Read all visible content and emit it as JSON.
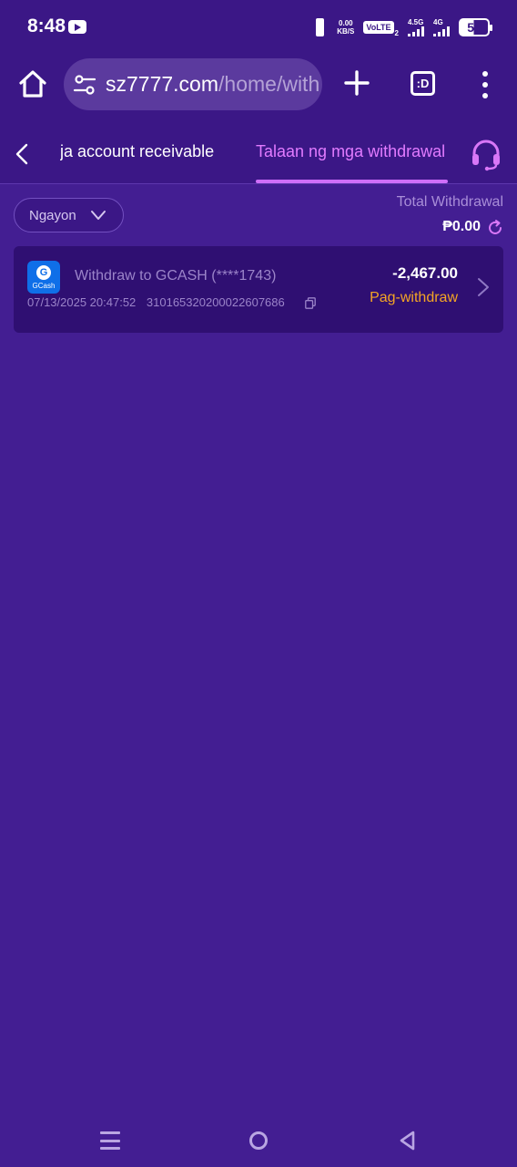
{
  "status_bar": {
    "time": "8:48",
    "net_speed_value": "0.00",
    "net_speed_unit": "KB/S",
    "volte": "VoLTE",
    "volte_sim": "2",
    "signal1_label": "4.5G",
    "signal2_label": "4G",
    "battery": "53"
  },
  "browser": {
    "url_host": "sz7777.com",
    "url_path": "/home/with",
    "tabs_label": ":D"
  },
  "header": {
    "tab_receivable": "ja account receivable",
    "tab_withdrawal": "Talaan ng mga withdrawal"
  },
  "filter": {
    "selected": "Ngayon",
    "total_label": "Total Withdrawal",
    "total_amount": "₱0.00"
  },
  "records": [
    {
      "logo_letter": "G",
      "logo_text": "GCash",
      "title": "Withdraw to GCASH (****1743)",
      "datetime": "07/13/2025 20:47:52",
      "order_id": "310165320200022607686",
      "amount": "-2,467.00",
      "status": "Pag-withdraw"
    }
  ],
  "colors": {
    "background": "#431e92",
    "header": "#3b1786",
    "card": "#2f0f72",
    "accent": "#e27bff",
    "status": "#f5a524"
  }
}
